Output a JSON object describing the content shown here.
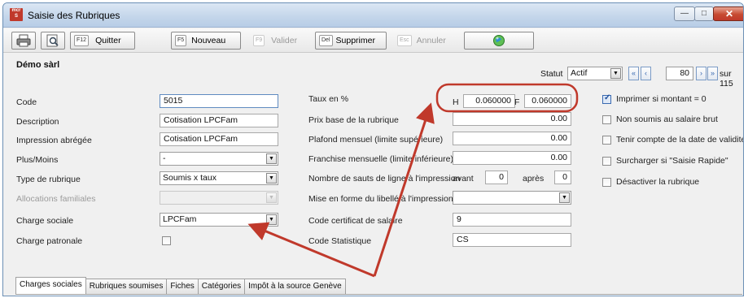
{
  "window": {
    "app_icon_text": "mcr S",
    "title": "Saisie des Rubriques",
    "min_glyph": "—",
    "max_glyph": "□",
    "close_glyph": "✕"
  },
  "toolbar": {
    "quit_key": "F12",
    "quit_label": "Quitter",
    "new_key": "F5",
    "new_label": "Nouveau",
    "validate_key": "F9",
    "validate_label": "Valider",
    "delete_key": "Del",
    "delete_label": "Supprimer",
    "cancel_key": "Esc",
    "cancel_label": "Annuler"
  },
  "header": {
    "company": "Démo sàrl",
    "statut_label": "Statut",
    "statut_value": "Actif",
    "record_number": "80",
    "record_total": "sur 115"
  },
  "left": {
    "code_label": "Code",
    "code_value": "5015",
    "description_label": "Description",
    "description_value": "Cotisation LPCFam",
    "short_label": "Impression abrégée",
    "short_value": "Cotisation LPCFam",
    "plus_minus_label": "Plus/Moins",
    "plus_minus_value": "-",
    "type_label": "Type de rubrique",
    "type_value": "Soumis x taux",
    "allocations_label": "Allocations familiales",
    "allocations_value": "",
    "charge_sociale_label": "Charge sociale",
    "charge_sociale_value": "LPCFam",
    "charge_patronale_label": "Charge patronale"
  },
  "middle": {
    "taux_label": "Taux en %",
    "taux_h_label": "H",
    "taux_h_value": "0.060000",
    "taux_f_label": "F",
    "taux_f_value": "0.060000",
    "prix_label": "Prix base de la rubrique",
    "prix_value": "0.00",
    "plafond_label": "Plafond mensuel (limite supérieure)",
    "plafond_value": "0.00",
    "franchise_label": "Franchise mensuelle (limite inférieure)",
    "franchise_value": "0.00",
    "sauts_label": "Nombre de sauts de ligne à l'impression",
    "avant_label": "avant",
    "avant_value": "0",
    "apres_label": "après",
    "apres_value": "0",
    "mise_label": "Mise en forme du libellé à l'impression",
    "mise_value": "",
    "certificat_label": "Code certificat de salaire",
    "certificat_value": "9",
    "statistique_label": "Code Statistique",
    "statistique_value": "CS"
  },
  "right": {
    "imprimer_label": "Imprimer si montant = 0",
    "non_soumis_label": "Non soumis au salaire brut",
    "validite_label": "Tenir compte de la date de validité",
    "surcharger_label": "Surcharger si \"Saisie Rapide\"",
    "desactiver_label": "Désactiver la rubrique"
  },
  "tabs": [
    "Charges sociales",
    "Rubriques soumises",
    "Fiches",
    "Catégories",
    "Impôt à la source Genève"
  ],
  "annotation_colors": {
    "arrow": "#c0392b",
    "outline": "#c0392b"
  }
}
